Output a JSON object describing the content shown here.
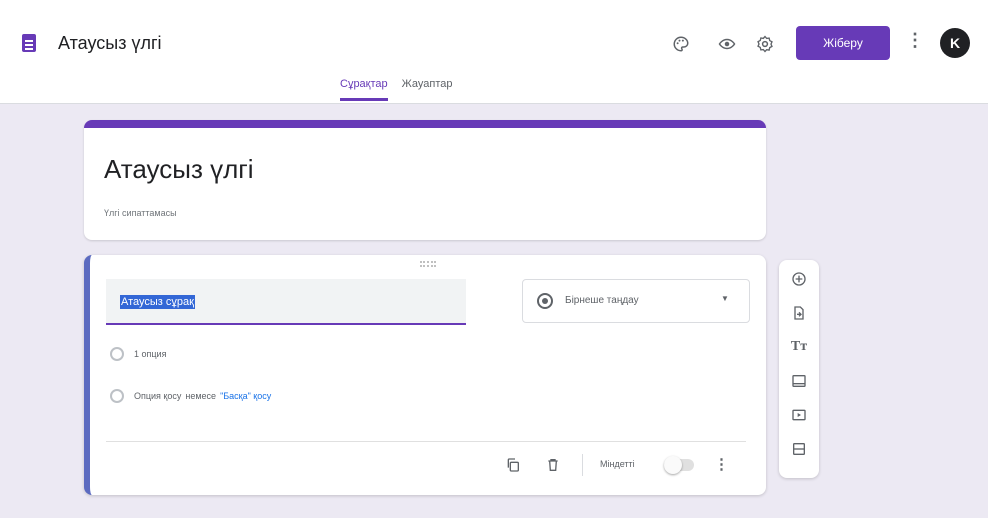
{
  "header": {
    "doc_title": "Атаусыз үлгі",
    "send_label": "Жіберу",
    "avatar_letter": "K",
    "icons": [
      "palette-icon",
      "eye-preview-icon",
      "settings-icon",
      "more-vert-icon"
    ],
    "tabs": [
      {
        "label": "Сұрақтар",
        "active": true
      },
      {
        "label": "Жауаптар",
        "active": false
      }
    ]
  },
  "title_card": {
    "title": "Атаусыз үлгі",
    "description": "Үлгі сипаттамасы"
  },
  "question": {
    "title_value": "Атаусыз сұрақ",
    "type_label": "Бірнеше таңдау",
    "options": [
      "1 опция"
    ],
    "add_option_label": "Опция қосу",
    "or_label": "немесе",
    "add_other_label": "\"Басқа\" қосу",
    "required_label": "Міндетті",
    "required_on": false
  },
  "side_toolbar": {
    "items": [
      "add-question-icon",
      "import-questions-icon",
      "add-title-icon",
      "add-image-icon",
      "add-video-icon",
      "add-section-icon"
    ]
  },
  "colors": {
    "accent": "#673ab7",
    "background": "#ece9f3",
    "question_border": "#5c6bc0"
  }
}
